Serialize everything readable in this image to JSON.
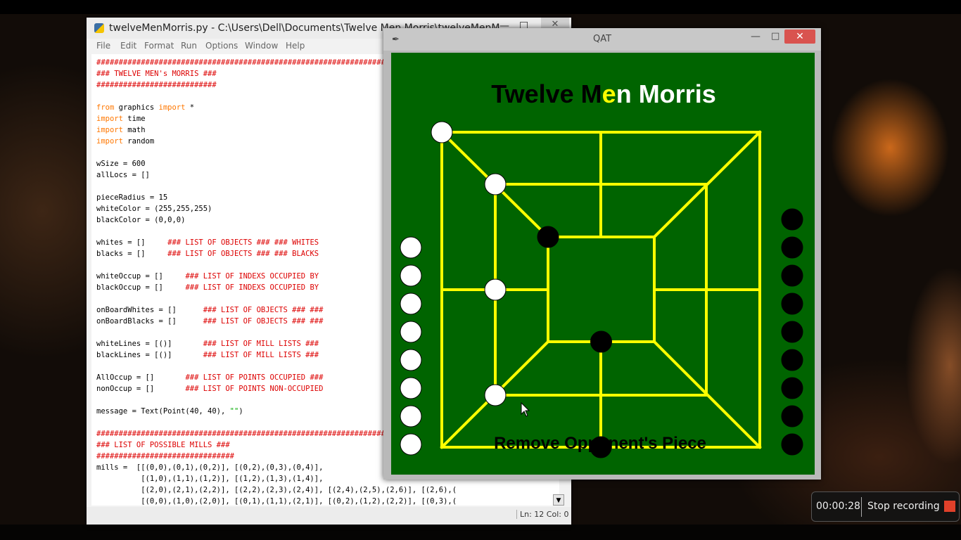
{
  "editor": {
    "title": "twelveMenMorris.py - C:\\Users\\Dell\\Documents\\Twelve Men Morris\\twelveMenM...",
    "menu": [
      "File",
      "Edit",
      "Format",
      "Run",
      "Options",
      "Window",
      "Help"
    ],
    "status": "Ln: 12 Col: 0",
    "code_lines": [
      [
        {
          "t": "#############################################################################",
          "c": "comment"
        }
      ],
      [
        {
          "t": "### TWELVE MEN's MORRIS ###",
          "c": "comment"
        }
      ],
      [
        {
          "t": "###########################",
          "c": "comment"
        }
      ],
      [],
      [
        {
          "t": "from",
          "c": "keyword"
        },
        {
          "t": " graphics "
        },
        {
          "t": "import",
          "c": "keyword"
        },
        {
          "t": " *"
        }
      ],
      [
        {
          "t": "import",
          "c": "keyword"
        },
        {
          "t": " time"
        }
      ],
      [
        {
          "t": "import",
          "c": "keyword"
        },
        {
          "t": " math"
        }
      ],
      [
        {
          "t": "import",
          "c": "keyword"
        },
        {
          "t": " random"
        }
      ],
      [],
      [
        {
          "t": "wSize = 600"
        }
      ],
      [
        {
          "t": "allLocs = []"
        }
      ],
      [],
      [
        {
          "t": "pieceRadius = 15"
        }
      ],
      [
        {
          "t": "whiteColor = (255,255,255)"
        }
      ],
      [
        {
          "t": "blackColor = (0,0,0)"
        }
      ],
      [],
      [
        {
          "t": "whites = []     "
        },
        {
          "t": "### LIST OF OBJECTS ### ### WHITES",
          "c": "comment"
        }
      ],
      [
        {
          "t": "blacks = []     "
        },
        {
          "t": "### LIST OF OBJECTS ### ### BLACKS",
          "c": "comment"
        }
      ],
      [],
      [
        {
          "t": "whiteOccup = []     "
        },
        {
          "t": "### LIST OF INDEXS OCCUPIED BY",
          "c": "comment"
        }
      ],
      [
        {
          "t": "blackOccup = []     "
        },
        {
          "t": "### LIST OF INDEXS OCCUPIED BY",
          "c": "comment"
        }
      ],
      [],
      [
        {
          "t": "onBoardWhites = []      "
        },
        {
          "t": "### LIST OF OBJECTS ### ###",
          "c": "comment"
        }
      ],
      [
        {
          "t": "onBoardBlacks = []      "
        },
        {
          "t": "### LIST OF OBJECTS ### ###",
          "c": "comment"
        }
      ],
      [],
      [
        {
          "t": "whiteLines = [()]       "
        },
        {
          "t": "### LIST OF MILL LISTS ###",
          "c": "comment"
        }
      ],
      [
        {
          "t": "blackLines = [()]       "
        },
        {
          "t": "### LIST OF MILL LISTS ###",
          "c": "comment"
        }
      ],
      [],
      [
        {
          "t": "AllOccup = []       "
        },
        {
          "t": "### LIST OF POINTS OCCUPIED ###",
          "c": "comment"
        }
      ],
      [
        {
          "t": "nonOccup = []       "
        },
        {
          "t": "### LIST OF POINTS NON-OCCUPIED",
          "c": "comment"
        }
      ],
      [],
      [
        {
          "t": "message = Text(Point(40, 40), "
        },
        {
          "t": "\"\"",
          "c": "string"
        },
        {
          "t": ")"
        }
      ],
      [],
      [
        {
          "t": "#############################################################################",
          "c": "comment"
        }
      ],
      [
        {
          "t": "### LIST OF POSSIBLE MILLS ###",
          "c": "comment"
        }
      ],
      [
        {
          "t": "###############################",
          "c": "comment"
        }
      ],
      [
        {
          "t": "mills =  [[(0,0),(0,1),(0,2)], [(0,2),(0,3),(0,4)],"
        }
      ],
      [
        {
          "t": "          [(1,0),(1,1),(1,2)], [(1,2),(1,3),(1,4)],"
        }
      ],
      [
        {
          "t": "          [(2,0),(2,1),(2,2)], [(2,2),(2,3),(2,4)], [(2,4),(2,5),(2,6)], [(2,6),("
        }
      ],
      [
        {
          "t": "          [(0,0),(1,0),(2,0)], [(0,1),(1,1),(2,1)], [(0,2),(1,2),(2,2)], [(0,3),("
        }
      ]
    ]
  },
  "qat": {
    "title": "QAT",
    "heading": {
      "part1": "Twelve M",
      "part2": "e",
      "part3": "n Morris"
    },
    "message": "Remove Opponent's Piece",
    "colors": {
      "board": "#006400",
      "line": "#ffff00",
      "white_piece": "#ffffff",
      "black_piece": "#000000",
      "heading_dark": "#000000",
      "heading_accent": "#ffff00",
      "heading_light": "#ffffff"
    },
    "white_reserve": 8,
    "black_reserve": 9,
    "white_on_board": [
      [
        0,
        0
      ],
      [
        1,
        0
      ],
      [
        1,
        7
      ],
      [
        1,
        6
      ]
    ],
    "black_on_board": [
      [
        2,
        0
      ],
      [
        2,
        5
      ],
      [
        0,
        5
      ]
    ]
  },
  "recorder": {
    "timer": "00:00:28",
    "stop_label": "Stop recording"
  }
}
